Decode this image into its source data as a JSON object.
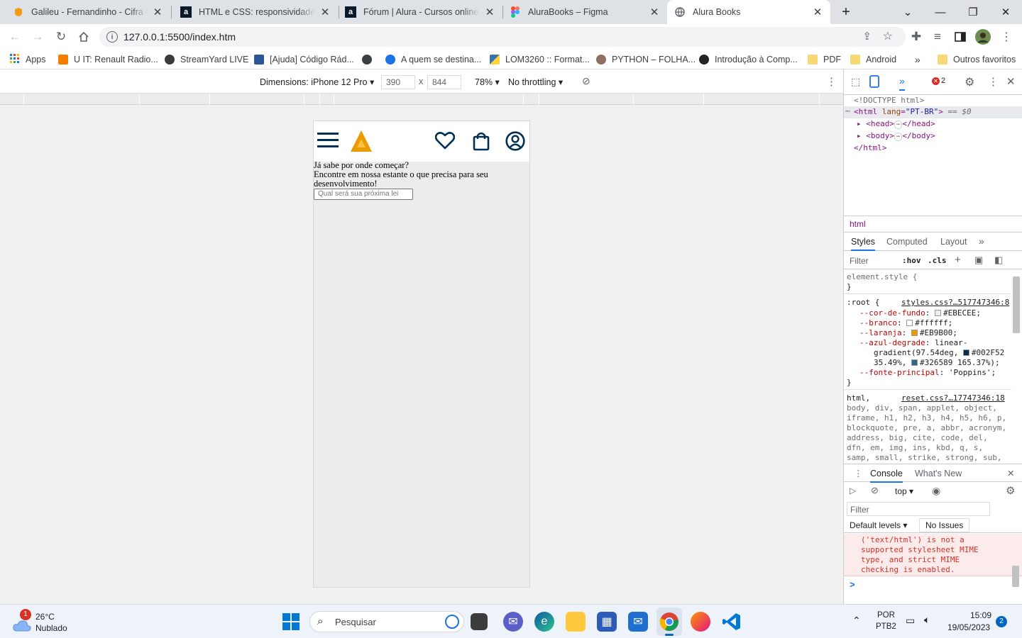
{
  "browser": {
    "tabs": [
      {
        "title": "Galileu - Fernandinho - Cifra Clu",
        "favicon": "cifraclub-icon",
        "active": false
      },
      {
        "title": "HTML e CSS: responsividade co",
        "favicon": "alura-icon",
        "active": false
      },
      {
        "title": "Fórum | Alura - Cursos online de",
        "favicon": "alura-icon",
        "active": false
      },
      {
        "title": "AluraBooks – Figma",
        "favicon": "figma-icon",
        "active": false
      },
      {
        "title": "Alura Books",
        "favicon": "globe-icon",
        "active": true
      }
    ],
    "new_tab": "+",
    "url": "127.0.0.1:5500/index.htm",
    "bookmarks": [
      {
        "label": "Apps",
        "icon": "apps-grid-icon"
      },
      {
        "label": "U IT: Renault Radio...",
        "icon": "blogger-icon"
      },
      {
        "label": "StreamYard LIVE",
        "icon": "streamyard-icon"
      },
      {
        "label": "[Ajuda] Código Rád...",
        "icon": "bookmark-icon"
      },
      {
        "label": "",
        "icon": "globe-icon"
      },
      {
        "label": "A quem se destina...",
        "icon": "c-icon"
      },
      {
        "label": "LOM3260 :: Format...",
        "icon": "python-icon"
      },
      {
        "label": "PYTHON – FOLHA...",
        "icon": "site-icon"
      },
      {
        "label": "Introdução à Comp...",
        "icon": "panda-icon"
      },
      {
        "label": "PDF",
        "icon": "folder-icon"
      },
      {
        "label": "Android",
        "icon": "folder-icon"
      }
    ],
    "bookmarks_overflow": "»",
    "other_bookmarks": "Outros favoritos"
  },
  "device_toolbar": {
    "dimensions_label": "Dimensions: iPhone 12 Pro",
    "width": "390",
    "times": "x",
    "height": "844",
    "zoom": "78%",
    "throttling": "No throttling"
  },
  "page": {
    "line1": "Já sabe por onde começar?",
    "line2": "Encontre em nossa estante o que precisa para seu",
    "line3": "desenvolvimento!",
    "search_placeholder": "Qual será sua próxima lei"
  },
  "devtools": {
    "error_count": "2",
    "doctype": "<!DOCTYPE html>",
    "html_open": "<html",
    "html_attr": "lang",
    "html_attr_value": "\"PT-BR\"",
    "html_suffix": "== $0",
    "head": "<head>",
    "head_close": "</head>",
    "body": "<body>",
    "body_close": "</body>",
    "html_close": "</html>",
    "breadcrumb": "html",
    "tabs": [
      "Styles",
      "Computed",
      "Layout",
      "»"
    ],
    "filter_placeholder": "Filter",
    "hov": ":hov",
    "cls": ".cls",
    "element_style": "element.style {",
    "close_brace": "}",
    "root_selector": ":root {",
    "root_source": "styles.css?…517747346:8",
    "vars": [
      {
        "name": "--cor-de-fundo",
        "value": "#EBECEE;",
        "color": "#EBECEE"
      },
      {
        "name": "--branco",
        "value": "#ffffff;",
        "color": "#ffffff"
      },
      {
        "name": "--laranja",
        "value": "#EB9B00;",
        "color": "#EB9B00"
      }
    ],
    "gradient_name": "--azul-degrade",
    "gradient_l1": "linear-",
    "gradient_l2": "gradient(97.54deg,",
    "gradient_c1": "#002F52",
    "gradient_l3": "35.49%,",
    "gradient_c2": "#326589",
    "gradient_l4": "165.37%);",
    "font_var_name": "--fonte-principal",
    "font_var_value": "'Poppins';",
    "reset_selector": "html,",
    "reset_source": "reset.css?…17747346:18",
    "reset_lines": [
      "body, div, span, applet, object,",
      "iframe, h1, h2, h3, h4, h5, h6, p,",
      "blockquote, pre, a, abbr, acronym,",
      "address, big, cite, code, del,",
      "dfn, em, img, ins, kbd, q, s,",
      "samp, small, strike, strong, sub,"
    ],
    "console_tabs": [
      "Console",
      "What's New"
    ],
    "context": "top",
    "console_filter": "Filter",
    "levels": "Default levels",
    "issues": "No Issues",
    "console_msg": [
      "('text/html') is not a",
      "supported stylesheet MIME",
      "type, and strict MIME",
      "checking is enabled."
    ],
    "prompt": ">"
  },
  "taskbar": {
    "weather_temp": "26°C",
    "weather_desc": "Nublado",
    "weather_badge": "1",
    "search_label": "Pesquisar",
    "lang1": "POR",
    "lang2": "PTB2",
    "time": "15:09",
    "date": "19/05/2023",
    "notif_count": "2"
  },
  "colors": {
    "laranja": "#EB9B00",
    "azul": "#002F52",
    "fundo": "#EBECEE",
    "error": "#d93025"
  }
}
